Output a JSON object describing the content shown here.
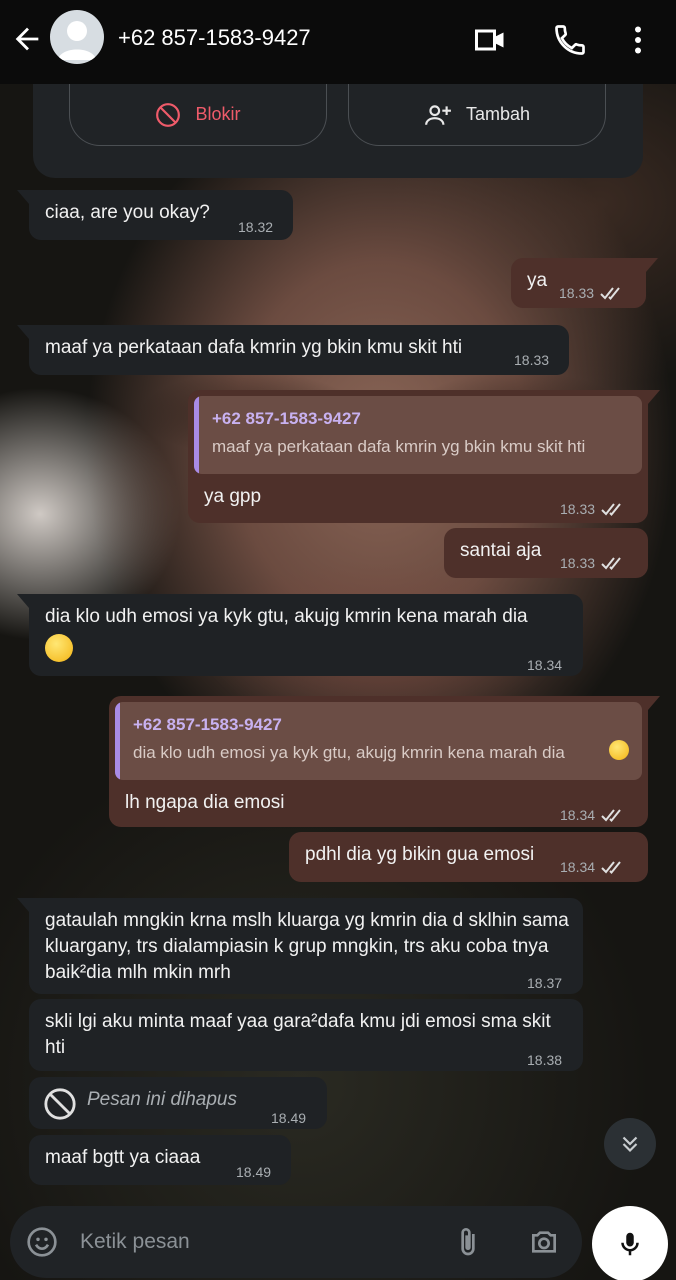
{
  "header": {
    "title": "+62 857-1583-9427"
  },
  "actions": {
    "block_label": "Blokir",
    "add_label": "Tambah"
  },
  "messages": [
    {
      "dir": "in",
      "text": "ciaa, are you okay?",
      "time": "18.32"
    },
    {
      "dir": "out",
      "text": "ya",
      "time": "18.33"
    },
    {
      "dir": "in",
      "text": "maaf ya perkataan dafa kmrin yg bkin kmu skit hti",
      "time": "18.33"
    },
    {
      "dir": "out",
      "quote_name": "+62 857-1583-9427",
      "quote_text": "maaf ya perkataan dafa kmrin yg bkin kmu skit hti",
      "text": "ya gpp",
      "time": "18.33"
    },
    {
      "dir": "out",
      "text": "santai aja",
      "time": "18.33"
    },
    {
      "dir": "in",
      "text": "dia klo udh emosi ya kyk gtu, akujg kmrin kena marah dia",
      "time": "18.34"
    },
    {
      "dir": "out",
      "quote_name": "+62 857-1583-9427",
      "quote_text": "dia klo udh emosi ya kyk gtu, akujg kmrin kena marah dia",
      "text": "lh ngapa dia emosi",
      "time": "18.34"
    },
    {
      "dir": "out",
      "text": "pdhl dia yg bikin gua emosi",
      "time": "18.34"
    },
    {
      "dir": "in",
      "text": "gataulah mngkin krna mslh kluarga yg kmrin dia d sklhin sama kluargany, trs dialampiasin  k grup mngkin, trs aku coba tnya  baik²dia mlh mkin mrh",
      "time": "18.37"
    },
    {
      "dir": "in",
      "text": "skli lgi aku minta maaf yaa gara²dafa kmu jdi emosi sma skit hti",
      "time": "18.38"
    },
    {
      "dir": "in",
      "deleted": true,
      "text": "Pesan ini dihapus",
      "time": "18.49"
    },
    {
      "dir": "in",
      "text": "maaf bgtt ya ciaaa",
      "time": "18.49"
    }
  ],
  "composer": {
    "placeholder": "Ketik pesan"
  },
  "colors": {
    "incoming_bubble": "#1f2225",
    "outgoing_bubble": "#4e302a",
    "block_red": "#ef5b6a",
    "quote_purple": "#a98be6"
  },
  "icons": [
    "back-arrow-icon",
    "avatar-icon",
    "video-call-icon",
    "phone-icon",
    "more-vertical-icon",
    "block-icon",
    "add-contact-icon",
    "double-check-icon",
    "deleted-icon",
    "scroll-down-icon",
    "emoji-icon",
    "attach-icon",
    "camera-icon",
    "mic-icon"
  ]
}
